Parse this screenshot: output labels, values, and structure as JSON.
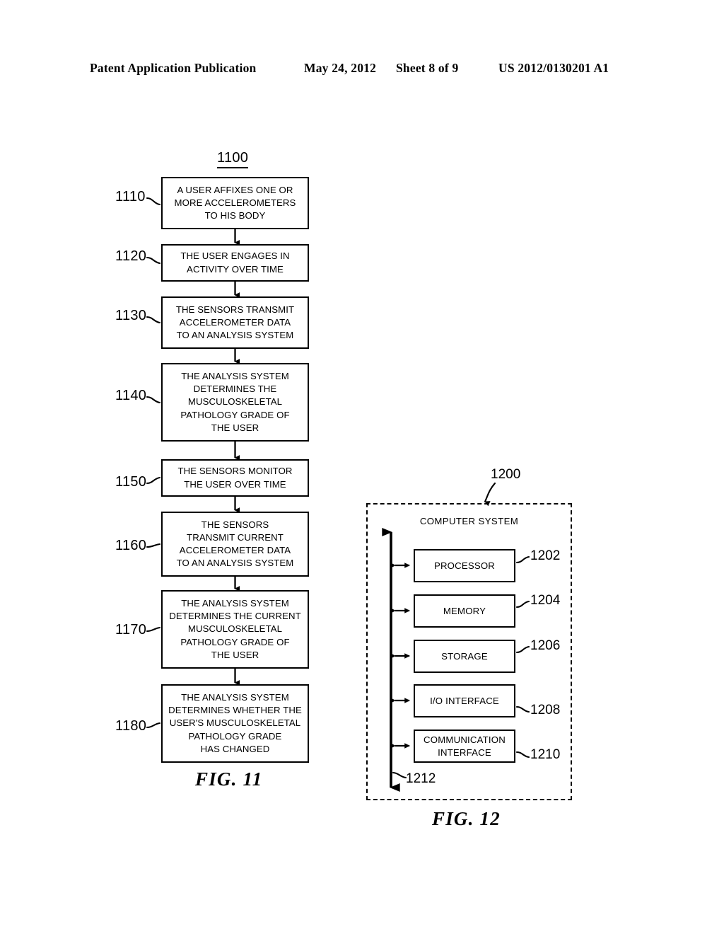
{
  "header": {
    "publication": "Patent Application Publication",
    "date": "May 24, 2012",
    "sheet": "Sheet 8 of 9",
    "patent_number": "US 2012/0130201 A1"
  },
  "figure_11": {
    "caption": "FIG. 11",
    "diagram_ref": "1100",
    "steps": [
      {
        "ref": "1110",
        "lines": [
          "A USER AFFIXES ONE OR",
          "MORE ACCELEROMETERS",
          "TO HIS BODY"
        ]
      },
      {
        "ref": "1120",
        "lines": [
          "THE USER ENGAGES IN",
          "ACTIVITY OVER TIME"
        ]
      },
      {
        "ref": "1130",
        "lines": [
          "THE SENSORS TRANSMIT",
          "ACCELEROMETER DATA",
          "TO AN ANALYSIS SYSTEM"
        ]
      },
      {
        "ref": "1140",
        "lines": [
          "THE ANALYSIS SYSTEM",
          "DETERMINES THE",
          "MUSCULOSKELETAL",
          "PATHOLOGY GRADE OF",
          "THE USER"
        ]
      },
      {
        "ref": "1150",
        "lines": [
          "THE SENSORS MONITOR",
          "THE USER OVER TIME"
        ]
      },
      {
        "ref": "1160",
        "lines": [
          "THE SENSORS",
          "TRANSMIT CURRENT",
          "ACCELEROMETER DATA",
          "TO AN ANALYSIS SYSTEM"
        ]
      },
      {
        "ref": "1170",
        "lines": [
          "THE ANALYSIS SYSTEM",
          "DETERMINES THE CURRENT",
          "MUSCULOSKELETAL",
          "PATHOLOGY GRADE OF",
          "THE USER"
        ]
      },
      {
        "ref": "1180",
        "lines": [
          "THE ANALYSIS SYSTEM",
          "DETERMINES WHETHER THE",
          "USER'S MUSCULOSKELETAL",
          "PATHOLOGY GRADE",
          "HAS CHANGED"
        ]
      }
    ]
  },
  "figure_12": {
    "caption": "FIG. 12",
    "system_ref": "1200",
    "system_title": "COMPUTER SYSTEM",
    "bus_ref": "1212",
    "components": [
      {
        "ref": "1202",
        "lines": [
          "PROCESSOR"
        ]
      },
      {
        "ref": "1204",
        "lines": [
          "MEMORY"
        ]
      },
      {
        "ref": "1206",
        "lines": [
          "STORAGE"
        ]
      },
      {
        "ref": "1208",
        "lines": [
          "I/O",
          "INTERFACE"
        ]
      },
      {
        "ref": "1210",
        "lines": [
          "COMMUNICATION",
          "INTERFACE"
        ]
      }
    ]
  },
  "colors": {
    "ink": "#000000",
    "paper": "#ffffff"
  }
}
